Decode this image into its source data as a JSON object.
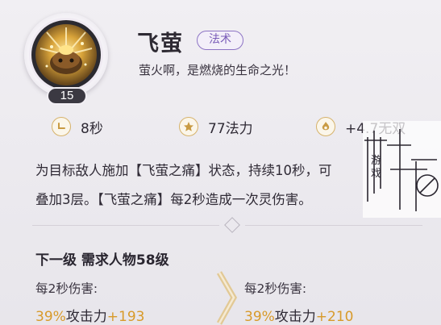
{
  "skill": {
    "name": "飞萤",
    "type": "法术",
    "flavor": "萤火啊，是燃烧的生命之光！",
    "level": "15"
  },
  "stats": {
    "cooldown": "8秒",
    "mana": "77法力",
    "extra": "+4.7无双"
  },
  "description": {
    "line1": "为目标敌人施加【飞萤之痛】状态，持续10秒，可",
    "line2": "叠加3层。【飞萤之痛】每2秒造成一次灵伤害。"
  },
  "next_level": {
    "title": "下一级 需求人物58级",
    "current": {
      "label": "每2秒伤害:",
      "pct": "39%",
      "text": "攻击力",
      "plus": "+193"
    },
    "next": {
      "label": "每2秒伤害:",
      "pct": "39%",
      "text": "攻击力",
      "plus": "+210"
    }
  },
  "watermark": {
    "text": "游戏"
  },
  "colors": {
    "accent_gold": "#d89a2a",
    "type_purple": "#7a5cb8"
  }
}
